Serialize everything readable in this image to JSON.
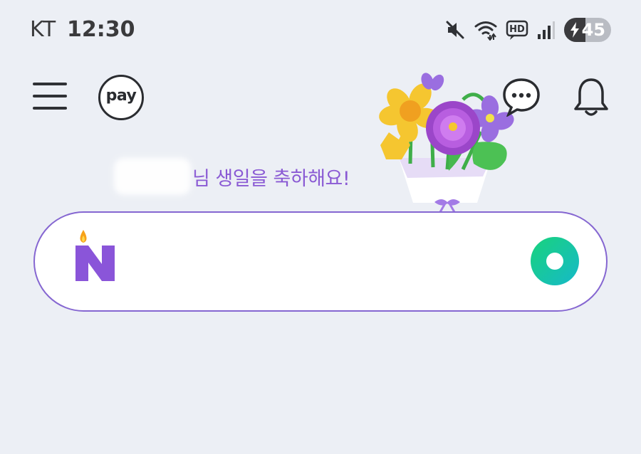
{
  "status_bar": {
    "carrier": "KT",
    "time": "12:30",
    "battery_percent": "45",
    "battery_level": 0.45,
    "hd_label": "HD",
    "icons": [
      "mute-icon",
      "wifi-icon",
      "hd-voice-icon",
      "signal-icon",
      "battery-icon"
    ]
  },
  "header": {
    "menu_icon": "hamburger-menu-icon",
    "pay_label": "pay",
    "talk_icon": "chat-bubble-icon",
    "notifications_icon": "bell-icon"
  },
  "greeting": {
    "text": "님 생일을 축하해요!"
  },
  "search": {
    "value": "",
    "placeholder": "",
    "logo_icon": "naver-birthday-candle-logo",
    "button_icon": "green-search-icon"
  },
  "colors": {
    "background": "#eceff5",
    "accent_purple": "#8566d1",
    "greeting_text": "#8a5ad4",
    "search_green": "#1ec96f",
    "icon_dark": "#2f3135"
  }
}
